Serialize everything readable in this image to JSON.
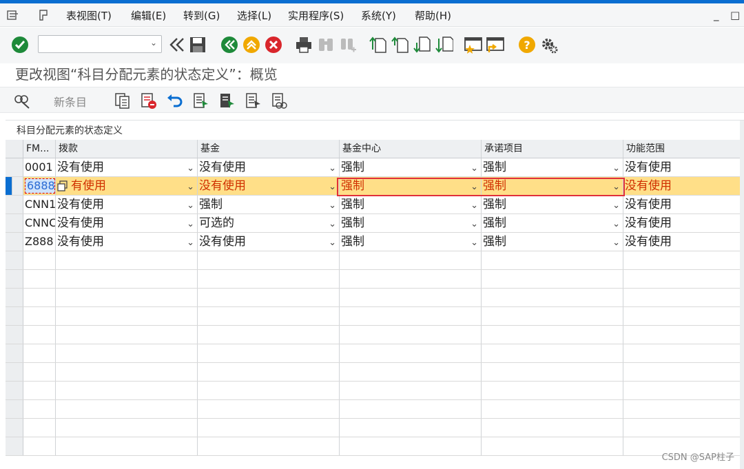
{
  "menu": {
    "items": [
      "表视图(T)",
      "编辑(E)",
      "转到(G)",
      "选择(L)",
      "实用程序(S)",
      "系统(Y)",
      "帮助(H)"
    ],
    "window_controls": [
      "_",
      "□"
    ]
  },
  "toolbar": {
    "command_field_value": "",
    "icons": [
      "check-icon",
      "back-arrows-icon",
      "save-icon",
      "back-green-icon",
      "exit-yellow-icon",
      "cancel-red-icon",
      "print-icon",
      "find-icon",
      "find-next-icon",
      "first-page-icon",
      "previous-page-icon",
      "next-page-icon",
      "last-page-icon",
      "create-session-icon",
      "shortcut-icon",
      "help-icon",
      "settings-icon"
    ]
  },
  "title": "更改视图“科目分配元素的状态定义”：概览",
  "app_toolbar": {
    "new_entries_label": "新条目"
  },
  "table": {
    "caption": "科目分配元素的状态定义",
    "columns": [
      "FM...",
      "拨款",
      "基金",
      "基金中心",
      "承诺项目",
      "功能范围"
    ],
    "rows": [
      {
        "key": "0001",
        "c1": "没有使用",
        "c2": "没有使用",
        "c3": "强制",
        "c4": "强制",
        "c5": "没有使用"
      },
      {
        "key": "6888",
        "c1": "有使用",
        "c2": "没有使用",
        "c3": "强制",
        "c4": "强制",
        "c5": "没有使用"
      },
      {
        "key": "CNN1",
        "c1": "没有使用",
        "c2": "强制",
        "c3": "强制",
        "c4": "强制",
        "c5": "没有使用"
      },
      {
        "key": "CNNC",
        "c1": "没有使用",
        "c2": "可选的",
        "c3": "强制",
        "c4": "强制",
        "c5": "没有使用"
      },
      {
        "key": "Z888",
        "c1": "没有使用",
        "c2": "没有使用",
        "c3": "强制",
        "c4": "强制",
        "c5": "没有使用"
      }
    ],
    "selected_row_index": 1
  },
  "watermark": "CSDN @SAP柱子",
  "colors": {
    "accent": "#0a6ed1",
    "selected_row": "#ffdf88",
    "highlight_border": "#e0303a",
    "changed_text": "#d03000"
  }
}
